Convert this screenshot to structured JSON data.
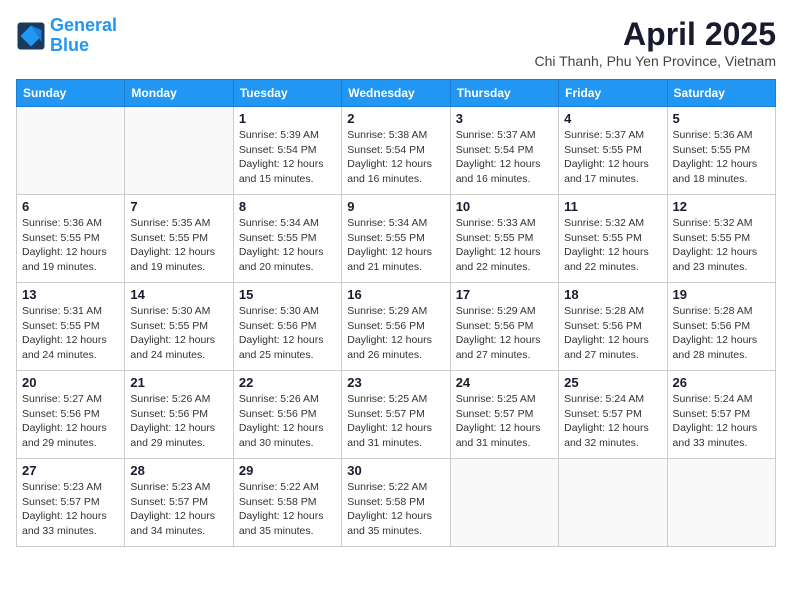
{
  "header": {
    "logo_line1": "General",
    "logo_line2": "Blue",
    "month_title": "April 2025",
    "subtitle": "Chi Thanh, Phu Yen Province, Vietnam"
  },
  "weekdays": [
    "Sunday",
    "Monday",
    "Tuesday",
    "Wednesday",
    "Thursday",
    "Friday",
    "Saturday"
  ],
  "weeks": [
    [
      {
        "num": "",
        "info": ""
      },
      {
        "num": "",
        "info": ""
      },
      {
        "num": "1",
        "info": "Sunrise: 5:39 AM\nSunset: 5:54 PM\nDaylight: 12 hours and 15 minutes."
      },
      {
        "num": "2",
        "info": "Sunrise: 5:38 AM\nSunset: 5:54 PM\nDaylight: 12 hours and 16 minutes."
      },
      {
        "num": "3",
        "info": "Sunrise: 5:37 AM\nSunset: 5:54 PM\nDaylight: 12 hours and 16 minutes."
      },
      {
        "num": "4",
        "info": "Sunrise: 5:37 AM\nSunset: 5:55 PM\nDaylight: 12 hours and 17 minutes."
      },
      {
        "num": "5",
        "info": "Sunrise: 5:36 AM\nSunset: 5:55 PM\nDaylight: 12 hours and 18 minutes."
      }
    ],
    [
      {
        "num": "6",
        "info": "Sunrise: 5:36 AM\nSunset: 5:55 PM\nDaylight: 12 hours and 19 minutes."
      },
      {
        "num": "7",
        "info": "Sunrise: 5:35 AM\nSunset: 5:55 PM\nDaylight: 12 hours and 19 minutes."
      },
      {
        "num": "8",
        "info": "Sunrise: 5:34 AM\nSunset: 5:55 PM\nDaylight: 12 hours and 20 minutes."
      },
      {
        "num": "9",
        "info": "Sunrise: 5:34 AM\nSunset: 5:55 PM\nDaylight: 12 hours and 21 minutes."
      },
      {
        "num": "10",
        "info": "Sunrise: 5:33 AM\nSunset: 5:55 PM\nDaylight: 12 hours and 22 minutes."
      },
      {
        "num": "11",
        "info": "Sunrise: 5:32 AM\nSunset: 5:55 PM\nDaylight: 12 hours and 22 minutes."
      },
      {
        "num": "12",
        "info": "Sunrise: 5:32 AM\nSunset: 5:55 PM\nDaylight: 12 hours and 23 minutes."
      }
    ],
    [
      {
        "num": "13",
        "info": "Sunrise: 5:31 AM\nSunset: 5:55 PM\nDaylight: 12 hours and 24 minutes."
      },
      {
        "num": "14",
        "info": "Sunrise: 5:30 AM\nSunset: 5:55 PM\nDaylight: 12 hours and 24 minutes."
      },
      {
        "num": "15",
        "info": "Sunrise: 5:30 AM\nSunset: 5:56 PM\nDaylight: 12 hours and 25 minutes."
      },
      {
        "num": "16",
        "info": "Sunrise: 5:29 AM\nSunset: 5:56 PM\nDaylight: 12 hours and 26 minutes."
      },
      {
        "num": "17",
        "info": "Sunrise: 5:29 AM\nSunset: 5:56 PM\nDaylight: 12 hours and 27 minutes."
      },
      {
        "num": "18",
        "info": "Sunrise: 5:28 AM\nSunset: 5:56 PM\nDaylight: 12 hours and 27 minutes."
      },
      {
        "num": "19",
        "info": "Sunrise: 5:28 AM\nSunset: 5:56 PM\nDaylight: 12 hours and 28 minutes."
      }
    ],
    [
      {
        "num": "20",
        "info": "Sunrise: 5:27 AM\nSunset: 5:56 PM\nDaylight: 12 hours and 29 minutes."
      },
      {
        "num": "21",
        "info": "Sunrise: 5:26 AM\nSunset: 5:56 PM\nDaylight: 12 hours and 29 minutes."
      },
      {
        "num": "22",
        "info": "Sunrise: 5:26 AM\nSunset: 5:56 PM\nDaylight: 12 hours and 30 minutes."
      },
      {
        "num": "23",
        "info": "Sunrise: 5:25 AM\nSunset: 5:57 PM\nDaylight: 12 hours and 31 minutes."
      },
      {
        "num": "24",
        "info": "Sunrise: 5:25 AM\nSunset: 5:57 PM\nDaylight: 12 hours and 31 minutes."
      },
      {
        "num": "25",
        "info": "Sunrise: 5:24 AM\nSunset: 5:57 PM\nDaylight: 12 hours and 32 minutes."
      },
      {
        "num": "26",
        "info": "Sunrise: 5:24 AM\nSunset: 5:57 PM\nDaylight: 12 hours and 33 minutes."
      }
    ],
    [
      {
        "num": "27",
        "info": "Sunrise: 5:23 AM\nSunset: 5:57 PM\nDaylight: 12 hours and 33 minutes."
      },
      {
        "num": "28",
        "info": "Sunrise: 5:23 AM\nSunset: 5:57 PM\nDaylight: 12 hours and 34 minutes."
      },
      {
        "num": "29",
        "info": "Sunrise: 5:22 AM\nSunset: 5:58 PM\nDaylight: 12 hours and 35 minutes."
      },
      {
        "num": "30",
        "info": "Sunrise: 5:22 AM\nSunset: 5:58 PM\nDaylight: 12 hours and 35 minutes."
      },
      {
        "num": "",
        "info": ""
      },
      {
        "num": "",
        "info": ""
      },
      {
        "num": "",
        "info": ""
      }
    ]
  ]
}
